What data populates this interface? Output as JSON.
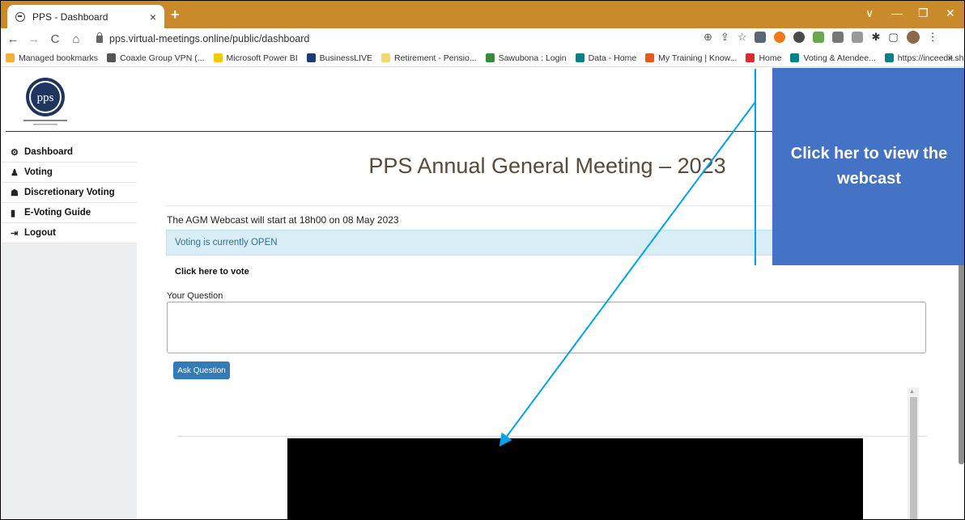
{
  "browser": {
    "tab_title": "PPS - Dashboard",
    "tab_close": "×",
    "new_tab": "+",
    "window_controls": [
      "∨",
      "—",
      "❐",
      "✕"
    ],
    "url": "pps.virtual-meetings.online/public/dashboard",
    "nav_icons": [
      "back-icon",
      "forward-icon",
      "reload-icon",
      "home-icon"
    ]
  },
  "bookmarks": [
    {
      "label": "Managed bookmarks",
      "color": "#f2b233"
    },
    {
      "label": "Coaxle Group VPN (...",
      "color": "#555555"
    },
    {
      "label": "Microsoft Power BI",
      "color": "#f2c811"
    },
    {
      "label": "BusinessLIVE",
      "color": "#1a3a7a"
    },
    {
      "label": "Retirement - Pensio...",
      "color": "#f5d76e"
    },
    {
      "label": "Sawubona : Login",
      "color": "#3a8a3a"
    },
    {
      "label": "Data - Home",
      "color": "#038387"
    },
    {
      "label": "My Training | Know...",
      "color": "#e8581c"
    },
    {
      "label": "Home",
      "color": "#d92c2c"
    },
    {
      "label": "Voting & Atendee...",
      "color": "#038387"
    },
    {
      "label": "https://inceedit.sha...",
      "color": "#038387"
    }
  ],
  "bookmarks_more": "»",
  "logo": {
    "text": "pps"
  },
  "sidebar": {
    "items": [
      {
        "label": "Dashboard",
        "icon": "⚙"
      },
      {
        "label": "Voting",
        "icon": "♟"
      },
      {
        "label": "Discretionary Voting",
        "icon": "☗"
      },
      {
        "label": "E-Voting Guide",
        "icon": "▮"
      },
      {
        "label": "Logout",
        "icon": "⇥"
      }
    ]
  },
  "main": {
    "title": "PPS Annual General Meeting – 2023",
    "webcast_info": "The AGM Webcast will start at 18h00 on 08 May 2023",
    "voting_status": "Voting is currently OPEN",
    "vote_link": "Click here to vote",
    "question_label": "Your Question",
    "question_value": "",
    "ask_button": "Ask Question"
  },
  "callout": {
    "text": "Click her to view the webcast",
    "color": "#4472c4",
    "arrow_color": "#00a2e8"
  }
}
